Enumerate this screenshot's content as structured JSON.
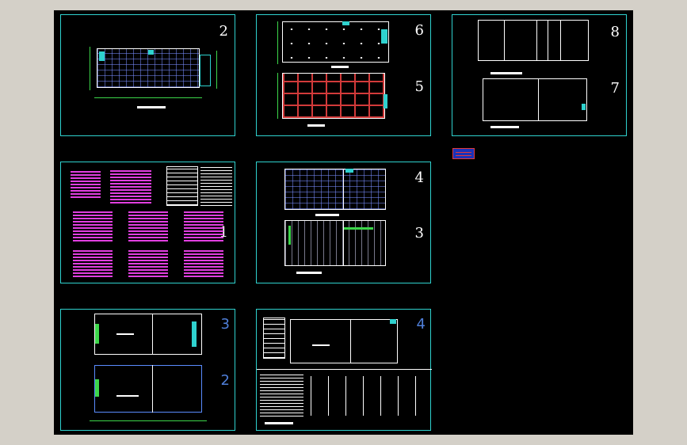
{
  "viewport": {
    "background": "#000000",
    "frame_color": "#d4d0c8",
    "sheet_border_color": "#2fd2cf"
  },
  "sheets": [
    {
      "id": "s-top-left",
      "numbers": [
        "2"
      ]
    },
    {
      "id": "s-top-mid",
      "numbers": [
        "6",
        "5"
      ]
    },
    {
      "id": "s-top-right",
      "numbers": [
        "8",
        "7"
      ]
    },
    {
      "id": "s-mid-left",
      "numbers": [
        "1"
      ]
    },
    {
      "id": "s-mid-mid",
      "numbers": [
        "4",
        "3"
      ]
    },
    {
      "id": "s-bot-left",
      "numbers": [
        "3",
        "2"
      ]
    },
    {
      "id": "s-bot-mid",
      "numbers": [
        "4"
      ]
    }
  ],
  "colors": {
    "cyan": "#2fd2cf",
    "green": "#3cd64a",
    "magenta": "#e13fe0",
    "red_grid": "#d23a3a",
    "blue_number": "#4f7fd9",
    "toolbar_fill": "#1a32b8",
    "toolbar_border": "#e23a3a"
  },
  "icons": [
    "floating-toolbar-icon"
  ]
}
